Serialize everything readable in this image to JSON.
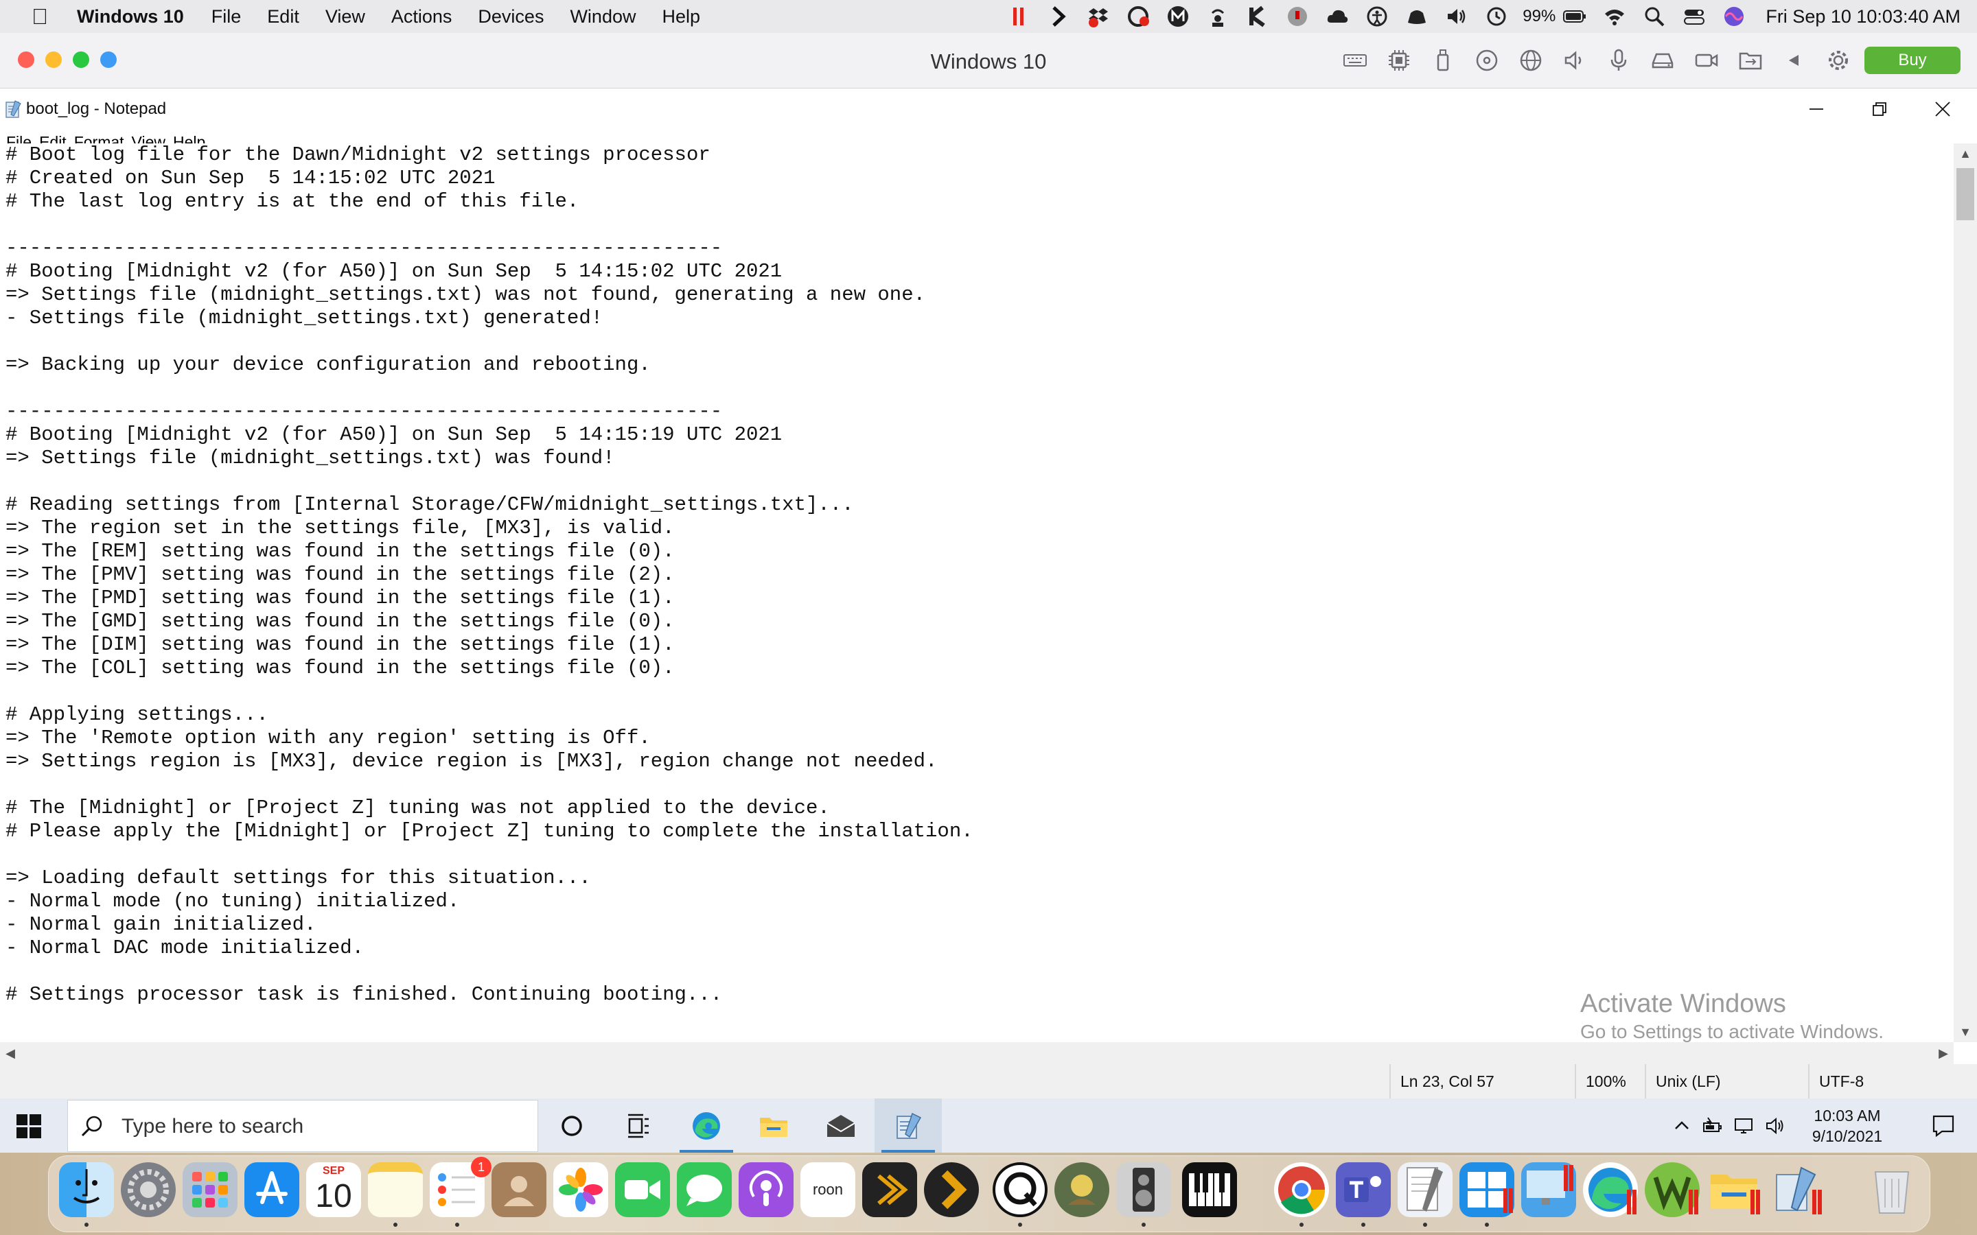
{
  "mac_menubar": {
    "app_name": "Windows 10",
    "menus": [
      "File",
      "Edit",
      "View",
      "Actions",
      "Devices",
      "Window",
      "Help"
    ],
    "battery_percent": "99%",
    "clock": "Fri Sep 10  10:03:40 AM"
  },
  "vm_window": {
    "title": "Windows 10",
    "buy_label": "Buy"
  },
  "notepad": {
    "title": "boot_log - Notepad",
    "menus": [
      "File",
      "Edit",
      "Format",
      "View",
      "Help"
    ],
    "content": "# Boot log file for the Dawn/Midnight v2 settings processor\n# Created on Sun Sep  5 14:15:02 UTC 2021\n# The last log entry is at the end of this file.\n\n------------------------------------------------------------\n# Booting [Midnight v2 (for A50)] on Sun Sep  5 14:15:02 UTC 2021\n=> Settings file (midnight_settings.txt) was not found, generating a new one.\n- Settings file (midnight_settings.txt) generated!\n\n=> Backing up your device configuration and rebooting.\n\n------------------------------------------------------------\n# Booting [Midnight v2 (for A50)] on Sun Sep  5 14:15:19 UTC 2021\n=> Settings file (midnight_settings.txt) was found!\n\n# Reading settings from [Internal Storage/CFW/midnight_settings.txt]...\n=> The region set in the settings file, [MX3], is valid.\n=> The [REM] setting was found in the settings file (0).\n=> The [PMV] setting was found in the settings file (2).\n=> The [PMD] setting was found in the settings file (1).\n=> The [GMD] setting was found in the settings file (0).\n=> The [DIM] setting was found in the settings file (1).\n=> The [COL] setting was found in the settings file (0).\n\n# Applying settings...\n=> The 'Remote option with any region' setting is Off.\n=> Settings region is [MX3], device region is [MX3], region change not needed.\n\n# The [Midnight] or [Project Z] tuning was not applied to the device.\n# Please apply the [Midnight] or [Project Z] tuning to complete the installation.\n\n=> Loading default settings for this situation...\n- Normal mode (no tuning) initialized.\n- Normal gain initialized.\n- Normal DAC mode initialized.\n\n# Settings processor task is finished. Continuing booting...",
    "status": {
      "position": "Ln 23, Col 57",
      "zoom": "100%",
      "line_ending": "Unix (LF)",
      "encoding": "UTF-8"
    }
  },
  "watermark": {
    "line1": "Activate Windows",
    "line2": "Go to Settings to activate Windows."
  },
  "taskbar": {
    "search_placeholder": "Type here to search",
    "time": "10:03 AM",
    "date": "9/10/2021"
  },
  "dock": {
    "calendar_month": "SEP",
    "calendar_day": "10",
    "reminders_badge": "1",
    "roon_label": "roon"
  },
  "colors": {
    "buy_green": "#5bb438",
    "traffic_red": "#fe5f57",
    "traffic_yellow": "#febc2e",
    "traffic_green": "#28c840",
    "traffic_blue": "#3d9bf5",
    "taskbar_accent": "#3b82c4"
  }
}
